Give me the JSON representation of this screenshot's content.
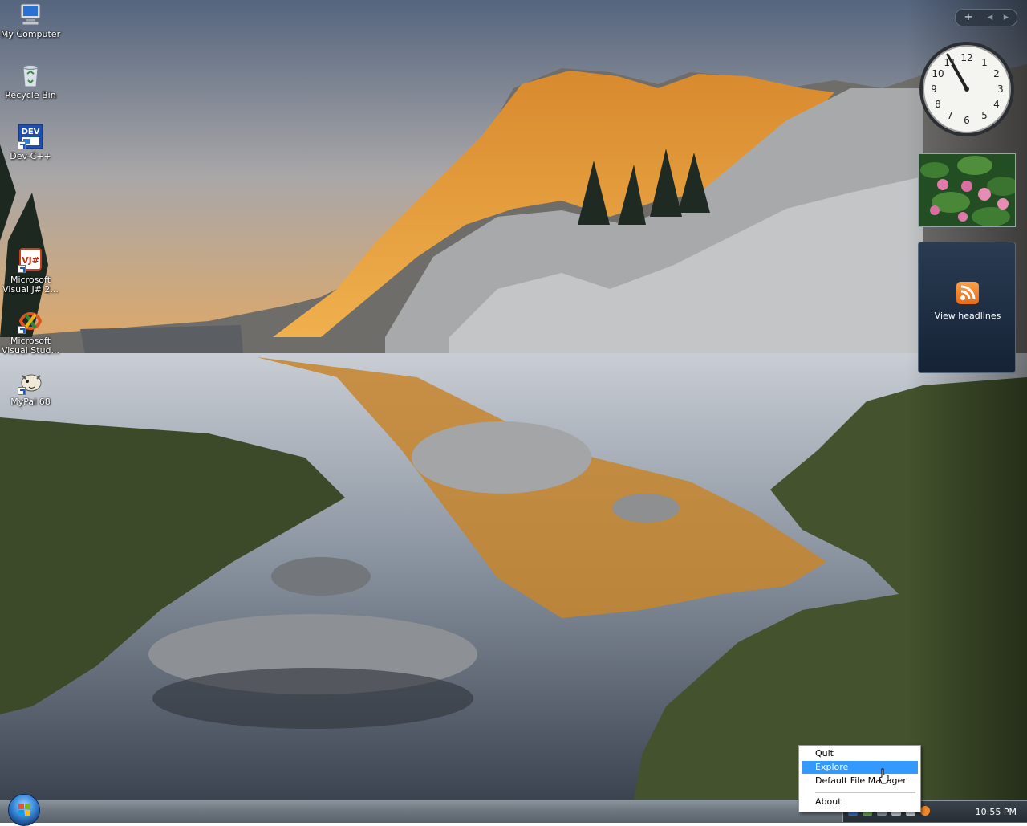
{
  "desktop": {
    "icons": [
      {
        "label": "My Computer",
        "icon": "my-computer-icon"
      },
      {
        "label": "Recycle Bin",
        "icon": "recycle-bin-icon"
      },
      {
        "label": "Dev-C++",
        "icon": "dev-cpp-icon",
        "badge": "DEV"
      },
      {
        "label": "Microsoft Visual J# 2...",
        "icon": "visual-j-sharp-icon",
        "badge": "VJ#"
      },
      {
        "label": "Microsoft Visual Stud...",
        "icon": "visual-studio-icon"
      },
      {
        "label": "MyPal 68",
        "icon": "mypal-icon"
      }
    ]
  },
  "sidebar": {
    "controls": {
      "add": "+",
      "prev": "◂",
      "next": "▸"
    },
    "clock": {
      "numerals": [
        "12",
        "1",
        "2",
        "3",
        "4",
        "5",
        "6",
        "7",
        "8",
        "9",
        "10",
        "11"
      ]
    },
    "feed_headlines_label": "View headlines"
  },
  "context_menu": {
    "items": [
      {
        "label": "Quit",
        "selected": false
      },
      {
        "label": "Explore",
        "selected": true
      },
      {
        "label": "Default File Manager",
        "selected": false
      },
      {
        "label": "About",
        "selected": false
      }
    ]
  },
  "taskbar": {
    "clock_time": "10:55 PM"
  },
  "colors": {
    "menu_highlight": "#3399ff",
    "rss_orange": "#f28a2a",
    "taskbar_gray": "#6e777f"
  }
}
